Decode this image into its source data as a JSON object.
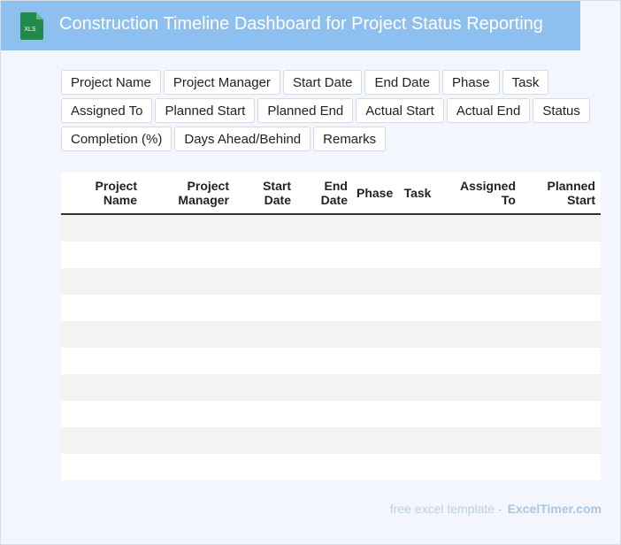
{
  "header": {
    "title": "Construction Timeline Dashboard for Project Status Reporting",
    "icon_label": "XLS",
    "icon": "xls-file-icon",
    "bg_color": "#8ec0ef",
    "icon_color": "#1f8a4c"
  },
  "fields": [
    "Project Name",
    "Project Manager",
    "Start Date",
    "End Date",
    "Phase",
    "Task",
    "Assigned To",
    "Planned Start",
    "Planned End",
    "Actual Start",
    "Actual End",
    "Status",
    "Completion (%)",
    "Days Ahead/Behind",
    "Remarks"
  ],
  "table": {
    "columns": [
      {
        "line1": "Project",
        "line2": "Name"
      },
      {
        "line1": "Project",
        "line2": "Manager"
      },
      {
        "line1": "Start",
        "line2": "Date"
      },
      {
        "line1": "End",
        "line2": "Date"
      },
      {
        "line1": "Phase",
        "line2": ""
      },
      {
        "line1": "Task",
        "line2": ""
      },
      {
        "line1": "Assigned",
        "line2": "To"
      },
      {
        "line1": "Planned",
        "line2": "Start"
      }
    ],
    "rows": [
      [
        "",
        "",
        "",
        "",
        "",
        "",
        "",
        ""
      ],
      [
        "",
        "",
        "",
        "",
        "",
        "",
        "",
        ""
      ],
      [
        "",
        "",
        "",
        "",
        "",
        "",
        "",
        ""
      ],
      [
        "",
        "",
        "",
        "",
        "",
        "",
        "",
        ""
      ],
      [
        "",
        "",
        "",
        "",
        "",
        "",
        "",
        ""
      ],
      [
        "",
        "",
        "",
        "",
        "",
        "",
        "",
        ""
      ],
      [
        "",
        "",
        "",
        "",
        "",
        "",
        "",
        ""
      ],
      [
        "",
        "",
        "",
        "",
        "",
        "",
        "",
        ""
      ],
      [
        "",
        "",
        "",
        "",
        "",
        "",
        "",
        ""
      ],
      [
        "",
        "",
        "",
        "",
        "",
        "",
        "",
        ""
      ]
    ]
  },
  "footer": {
    "prefix": "free excel template -",
    "brand": "ExcelTimer.com"
  }
}
